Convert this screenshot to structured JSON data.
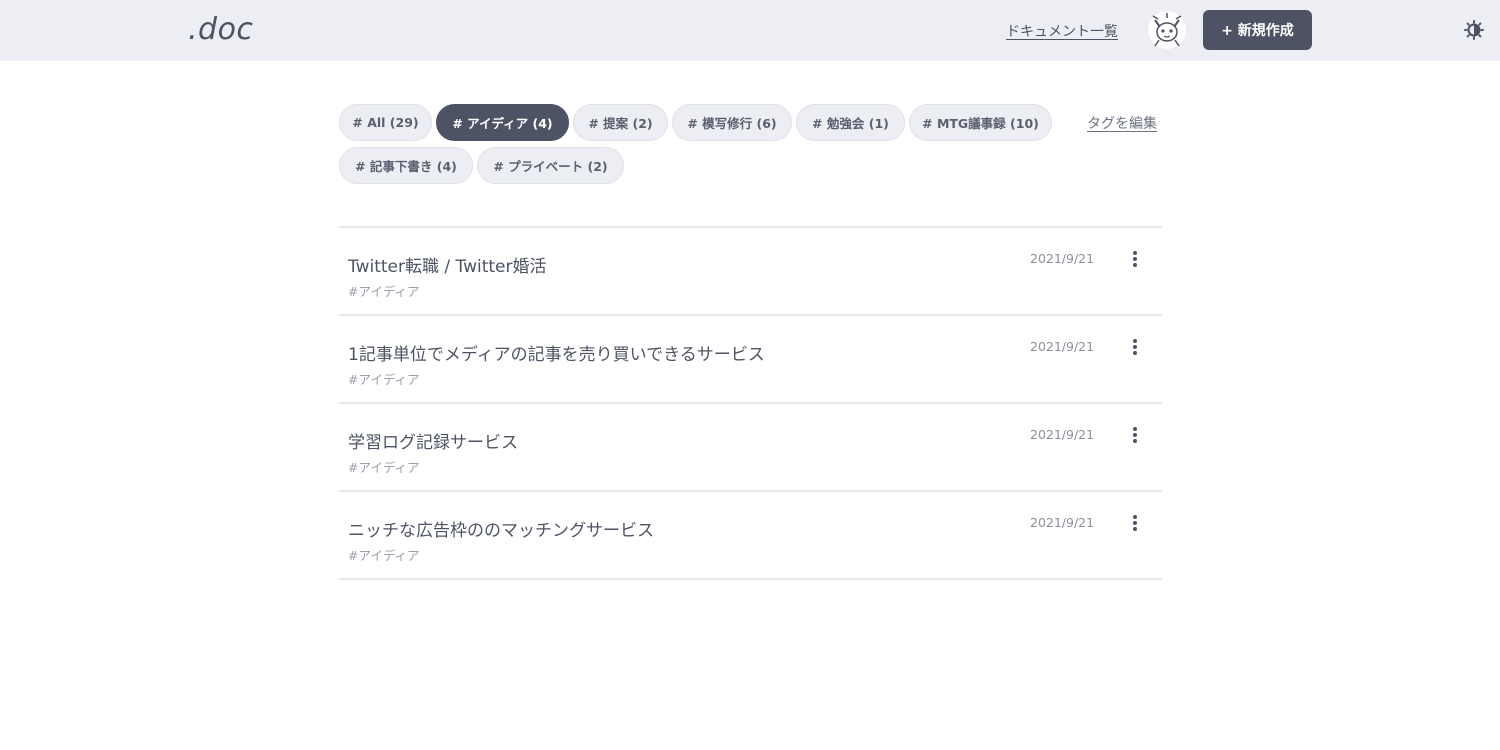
{
  "header": {
    "logo": ".doc",
    "doc_list_link": "ドキュメント一覧",
    "new_button": "+ 新規作成",
    "avatar_icon": "avatar-cat-icon",
    "theme_icon": "theme-toggle-icon"
  },
  "tags": {
    "items": [
      {
        "label": "# All (29)",
        "active": false
      },
      {
        "label": "# アイディア (4)",
        "active": true
      },
      {
        "label": "# 提案 (2)",
        "active": false
      },
      {
        "label": "# 模写修行 (6)",
        "active": false
      },
      {
        "label": "# 勉強会 (1)",
        "active": false
      },
      {
        "label": "# MTG議事録 (10)",
        "active": false
      },
      {
        "label": "# 記事下書き (4)",
        "active": false
      },
      {
        "label": "# プライベート (2)",
        "active": false
      }
    ],
    "edit_link": "タグを編集"
  },
  "documents": [
    {
      "title": "Twitter転職 / Twitter婚活",
      "tag": "#アイディア",
      "date": "2021/9/21"
    },
    {
      "title": "1記事単位でメディアの記事を売り買いできるサービス",
      "tag": "#アイディア",
      "date": "2021/9/21"
    },
    {
      "title": "学習ログ記録サービス",
      "tag": "#アイディア",
      "date": "2021/9/21"
    },
    {
      "title": "ニッチな広告枠ののマッチングサービス",
      "tag": "#アイディア",
      "date": "2021/9/21"
    }
  ],
  "colors": {
    "header_bg": "#eceef3",
    "primary": "#4d5364",
    "tag_bg": "#eceef3"
  }
}
